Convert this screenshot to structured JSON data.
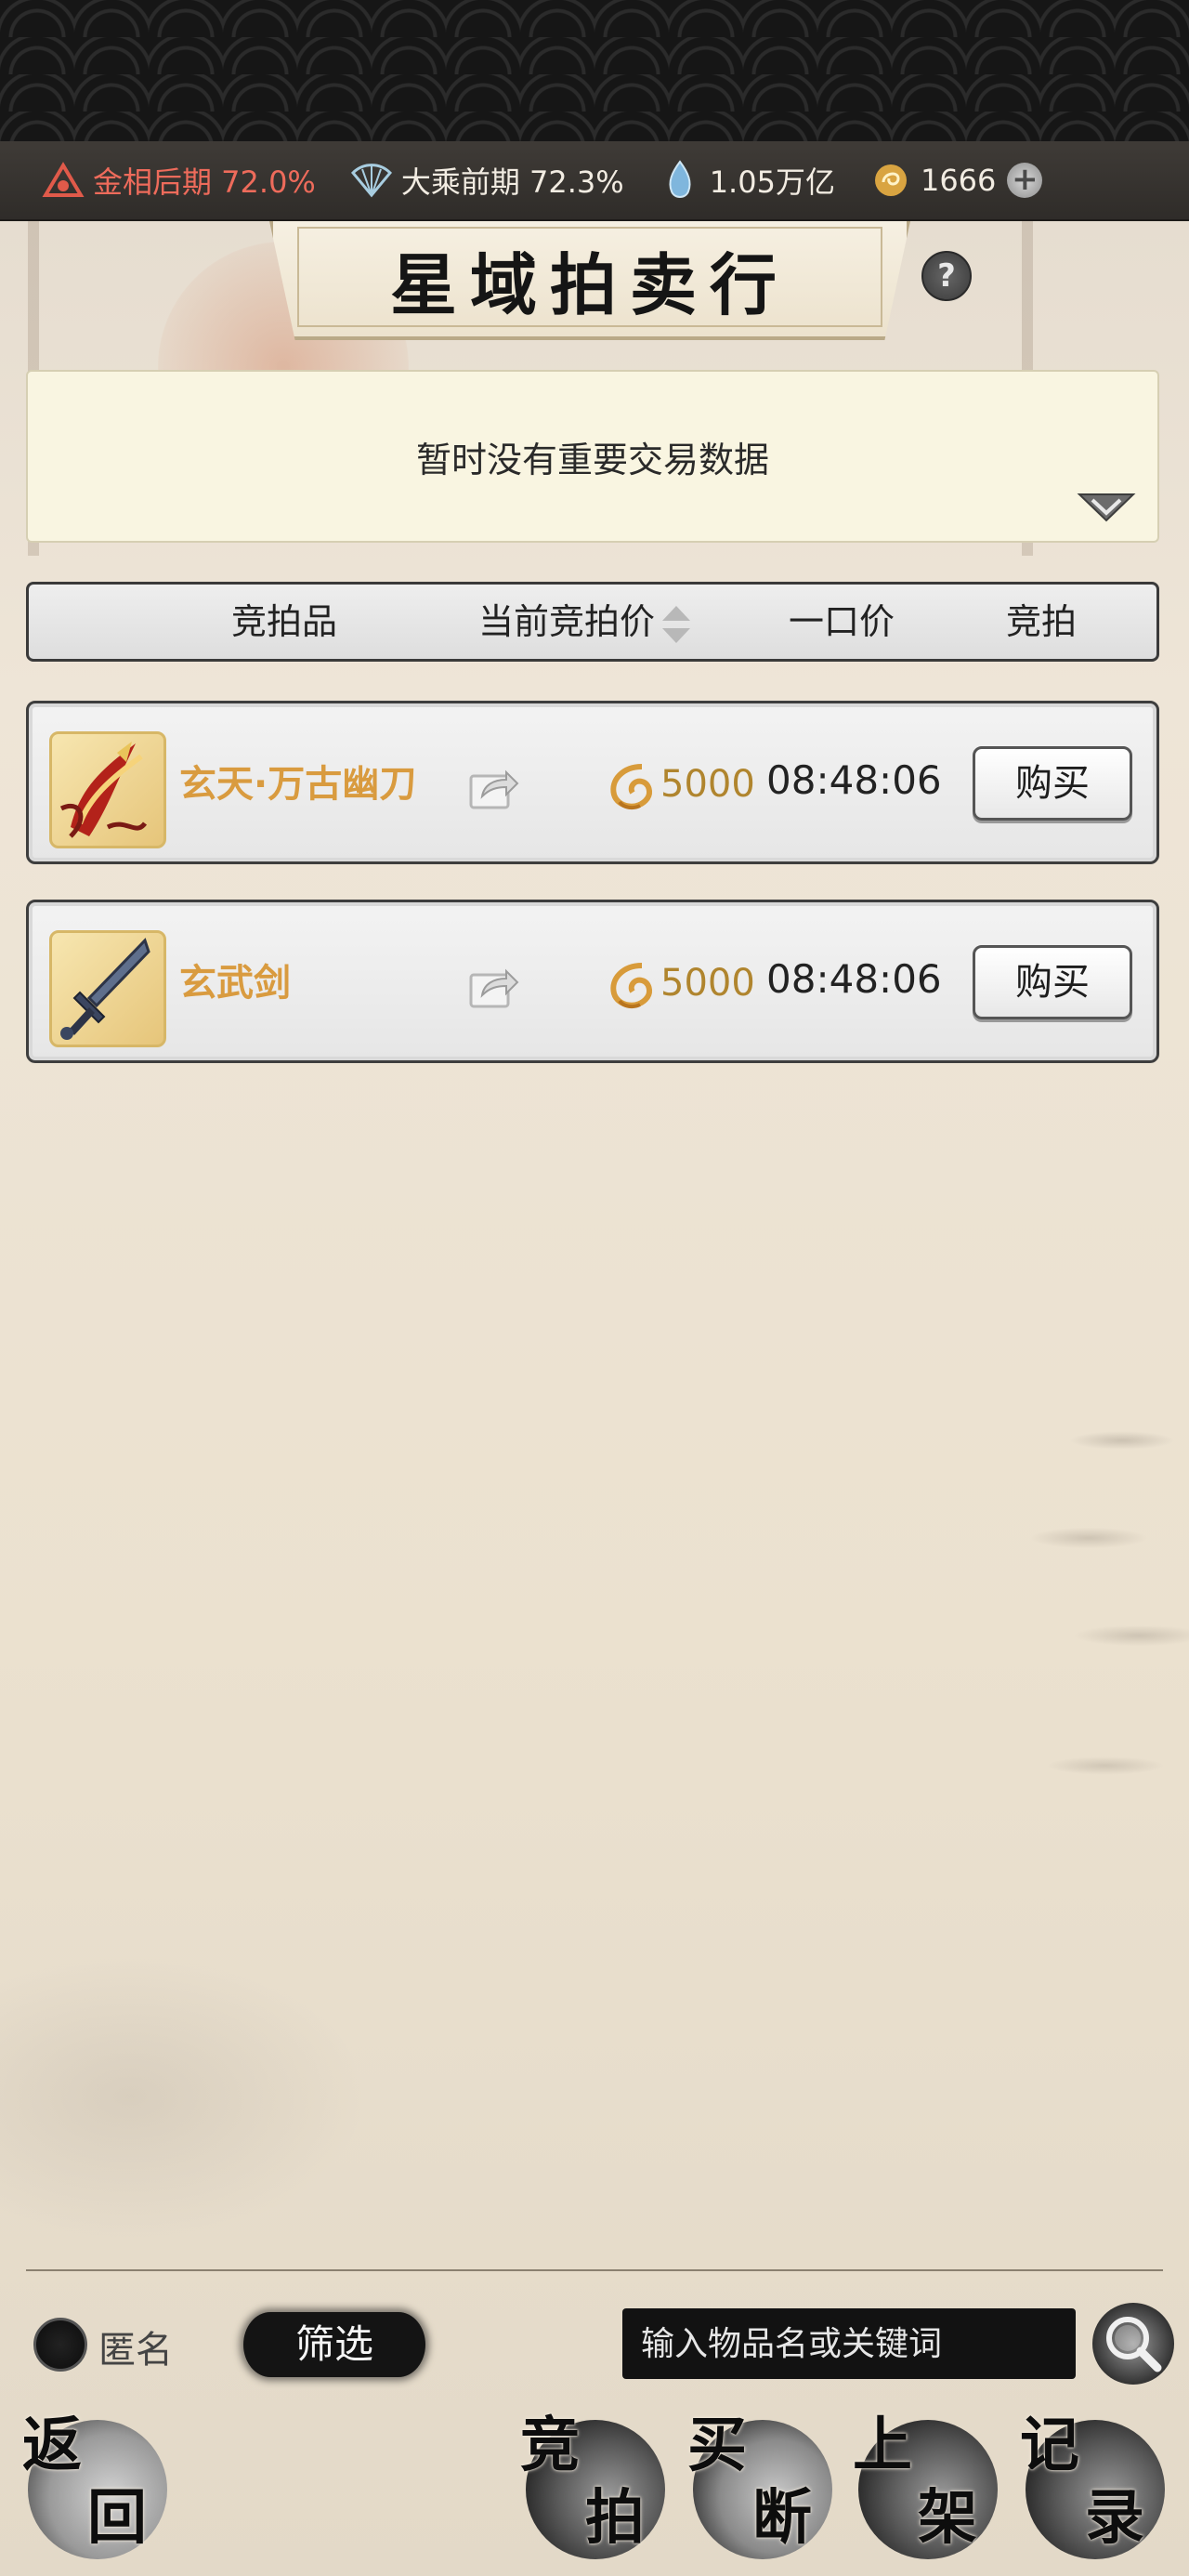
{
  "resources": [
    {
      "icon": "realm-icon",
      "label": "金相后期 72.0%"
    },
    {
      "icon": "fan-icon",
      "label": "大乘前期 72.3%"
    },
    {
      "icon": "spirit-stone-icon",
      "label": "1.05万亿"
    },
    {
      "icon": "coin-icon",
      "label": "1666"
    }
  ],
  "title": "星域拍卖行",
  "help_label": "?",
  "notice": "暂时没有重要交易数据",
  "columns": {
    "item": "竞拍品",
    "current_bid": "当前竞拍价",
    "buyout": "一口价",
    "bid": "竞拍"
  },
  "items": [
    {
      "name": "玄天·万古幽刀",
      "price": "5000",
      "time": "08:48:06",
      "buy_label": "购买"
    },
    {
      "name": "玄武剑",
      "price": "5000",
      "time": "08:48:06",
      "buy_label": "购买"
    }
  ],
  "bottom": {
    "anonymous_label": "匿名",
    "filter_label": "筛选",
    "search_placeholder": "输入物品名或关键词"
  },
  "nav": {
    "back": [
      "返",
      "回"
    ],
    "auction": [
      "竞",
      "拍"
    ],
    "buyout": [
      "买",
      "断"
    ],
    "list": [
      "上",
      "架"
    ],
    "records": [
      "记",
      "录"
    ]
  },
  "colors": {
    "realm_red": "#ee6b5b",
    "item_gold": "#d99b3f",
    "price_gold": "#b0852e"
  }
}
